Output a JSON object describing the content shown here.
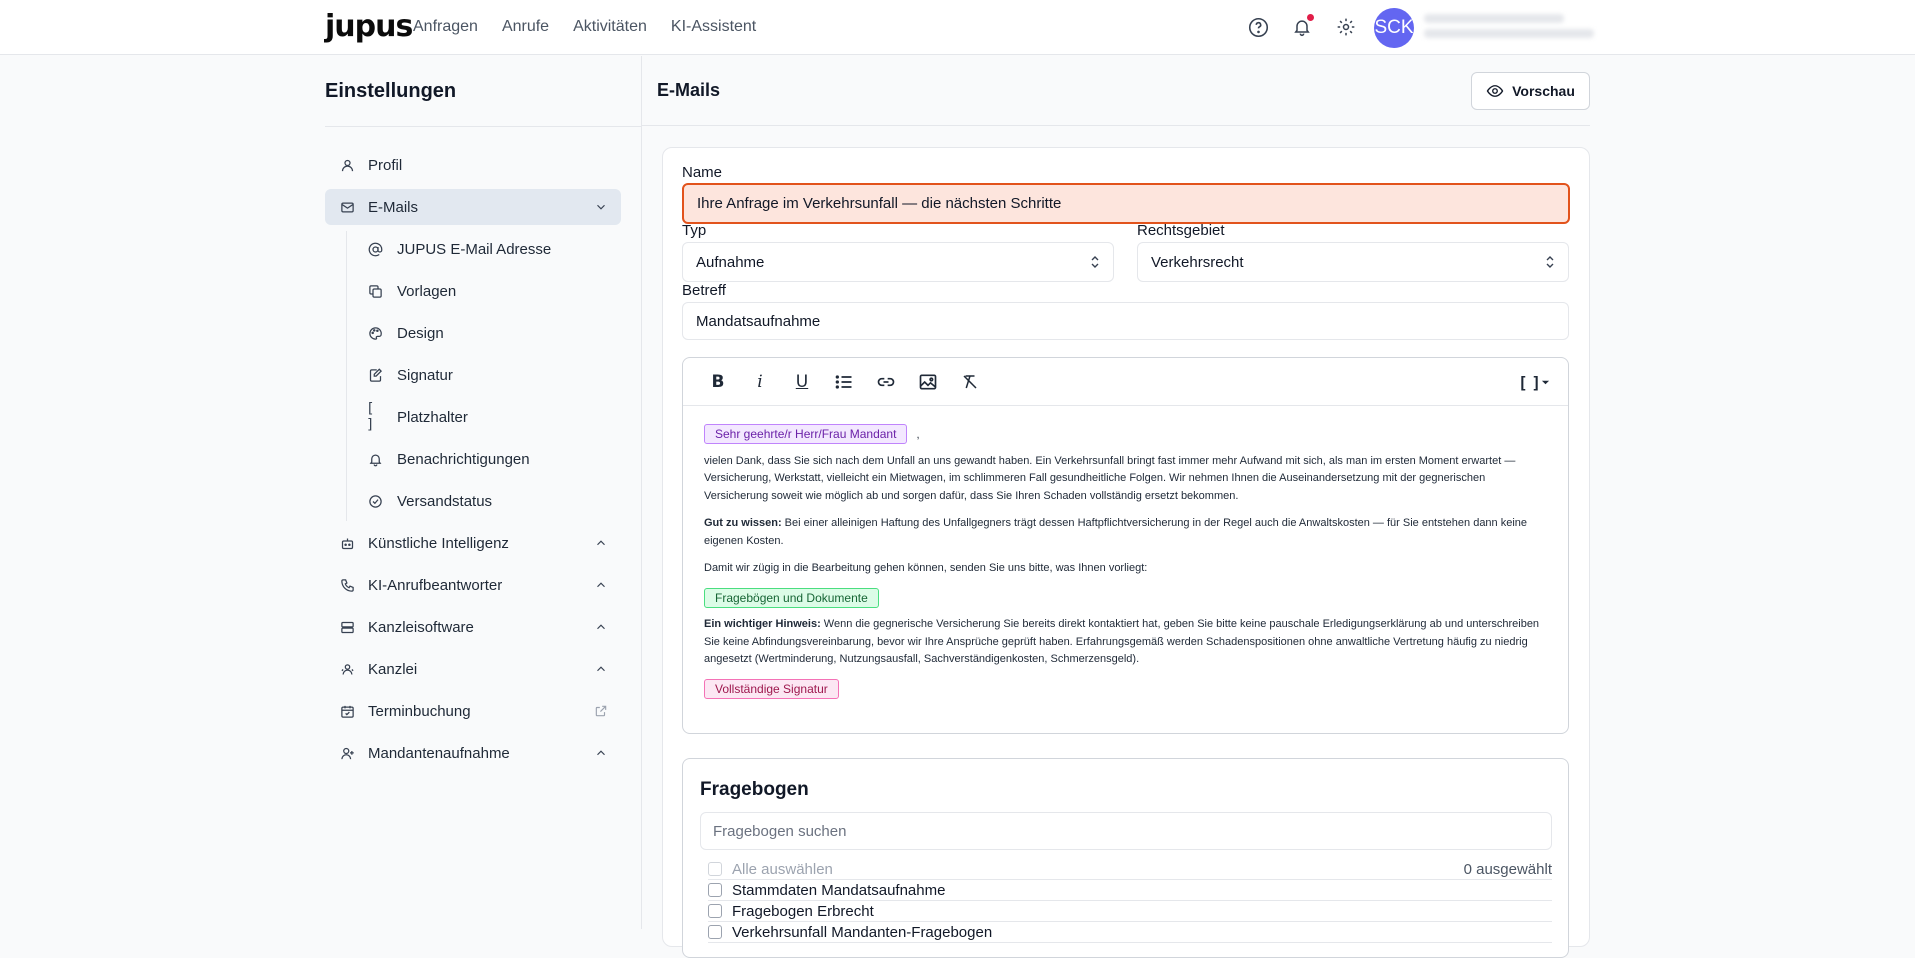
{
  "app": {
    "logo": "jupus"
  },
  "nav": [
    "Anfragen",
    "Anrufe",
    "Aktivitäten",
    "KI-Assistent"
  ],
  "user": {
    "initials": "SCK"
  },
  "colors": {
    "accent": "#6366f1",
    "highlight_bg": "#fde5dd",
    "highlight_border": "#e2531c",
    "notification": "#e11d48"
  },
  "sidebar": {
    "title": "Einstellungen",
    "items": [
      {
        "label": "Profil",
        "icon": "user-icon"
      },
      {
        "label": "E-Mails",
        "icon": "mail-icon",
        "active": true,
        "expanded": true
      },
      {
        "label": "Künstliche Intelligenz",
        "icon": "robot-icon"
      },
      {
        "label": "KI-Anrufbeantworter",
        "icon": "phone-icon"
      },
      {
        "label": "Kanzleisoftware",
        "icon": "server-icon"
      },
      {
        "label": "Kanzlei",
        "icon": "users-icon"
      },
      {
        "label": "Terminbuchung",
        "icon": "calendar-icon"
      },
      {
        "label": "Mandantenaufnahme",
        "icon": "user-plus-icon"
      }
    ],
    "subitems": [
      {
        "label": "JUPUS E-Mail Adresse",
        "icon": "at-icon"
      },
      {
        "label": "Vorlagen",
        "icon": "copy-icon"
      },
      {
        "label": "Design",
        "icon": "palette-icon"
      },
      {
        "label": "Signatur",
        "icon": "signature-icon"
      },
      {
        "label": "Platzhalter",
        "icon": "brackets-icon"
      },
      {
        "label": "Benachrichtigungen",
        "icon": "bell-icon"
      },
      {
        "label": "Versandstatus",
        "icon": "check-circle-icon"
      }
    ]
  },
  "main": {
    "title": "E-Mails",
    "preview_label": "Vorschau",
    "form": {
      "name_label": "Name",
      "name_value": "Ihre Anfrage im Verkehrsunfall — die nächsten Schritte",
      "type_label": "Typ",
      "type_value": "Aufnahme",
      "area_label": "Rechtsgebiet",
      "area_value": "Verkehrsrecht",
      "subject_label": "Betreff",
      "subject_value": "Mandatsaufnahme"
    },
    "editor": {
      "toolbar": {
        "bold": "B",
        "italic": "i",
        "underline": "U",
        "placeholder_menu": "[ ]"
      },
      "salutation_chip": "Sehr geehrte/r Herr/Frau Mandant",
      "salutation_suffix": ",",
      "p1": "vielen Dank, dass Sie sich nach dem Unfall an uns gewandt haben. Ein Verkehrsunfall bringt fast immer mehr Aufwand mit sich, als man im ersten Moment erwartet — Versicherung, Werkstatt, vielleicht ein Mietwagen, im schlimmeren Fall gesundheitliche Folgen. Wir nehmen Ihnen die Auseinandersetzung mit der gegnerischen Versicherung soweit wie möglich ab und sorgen dafür, dass Sie Ihren Schaden vollständig ersetzt bekommen.",
      "p2_bold": "Gut zu wissen:",
      "p2": " Bei einer alleinigen Haftung des Unfallgegners trägt dessen Haftpflichtversicherung in der Regel auch die Anwaltskosten — für Sie entstehen dann keine eigenen Kosten.",
      "p3": "Damit wir zügig in die Bearbeitung gehen können, senden Sie uns bitte, was Ihnen vorliegt:",
      "docs_chip": "Fragebögen und Dokumente",
      "p4_bold": "Ein wichtiger Hinweis:",
      "p4": " Wenn die gegnerische Versicherung Sie bereits direkt kontaktiert hat, geben Sie bitte keine pauschale Erledigungserklärung ab und unterschreiben Sie keine Abfindungsvereinbarung, bevor wir Ihre Ansprüche geprüft haben. Erfahrungsgemäß werden Schadenspositionen ohne anwaltliche Vertretung häufig zu niedrig angesetzt (Wertminderung, Nutzungsausfall, Sachverständigenkosten, Schmerzensgeld).",
      "signature_chip": "Vollständige Signatur"
    },
    "fragebogen": {
      "title": "Fragebogen",
      "search_placeholder": "Fragebogen suchen",
      "select_all": "Alle auswählen",
      "selected_count": "0 ausgewählt",
      "items": [
        "Stammdaten Mandatsaufnahme",
        "Fragebogen Erbrecht",
        "Verkehrsunfall Mandanten-Fragebogen"
      ]
    }
  }
}
